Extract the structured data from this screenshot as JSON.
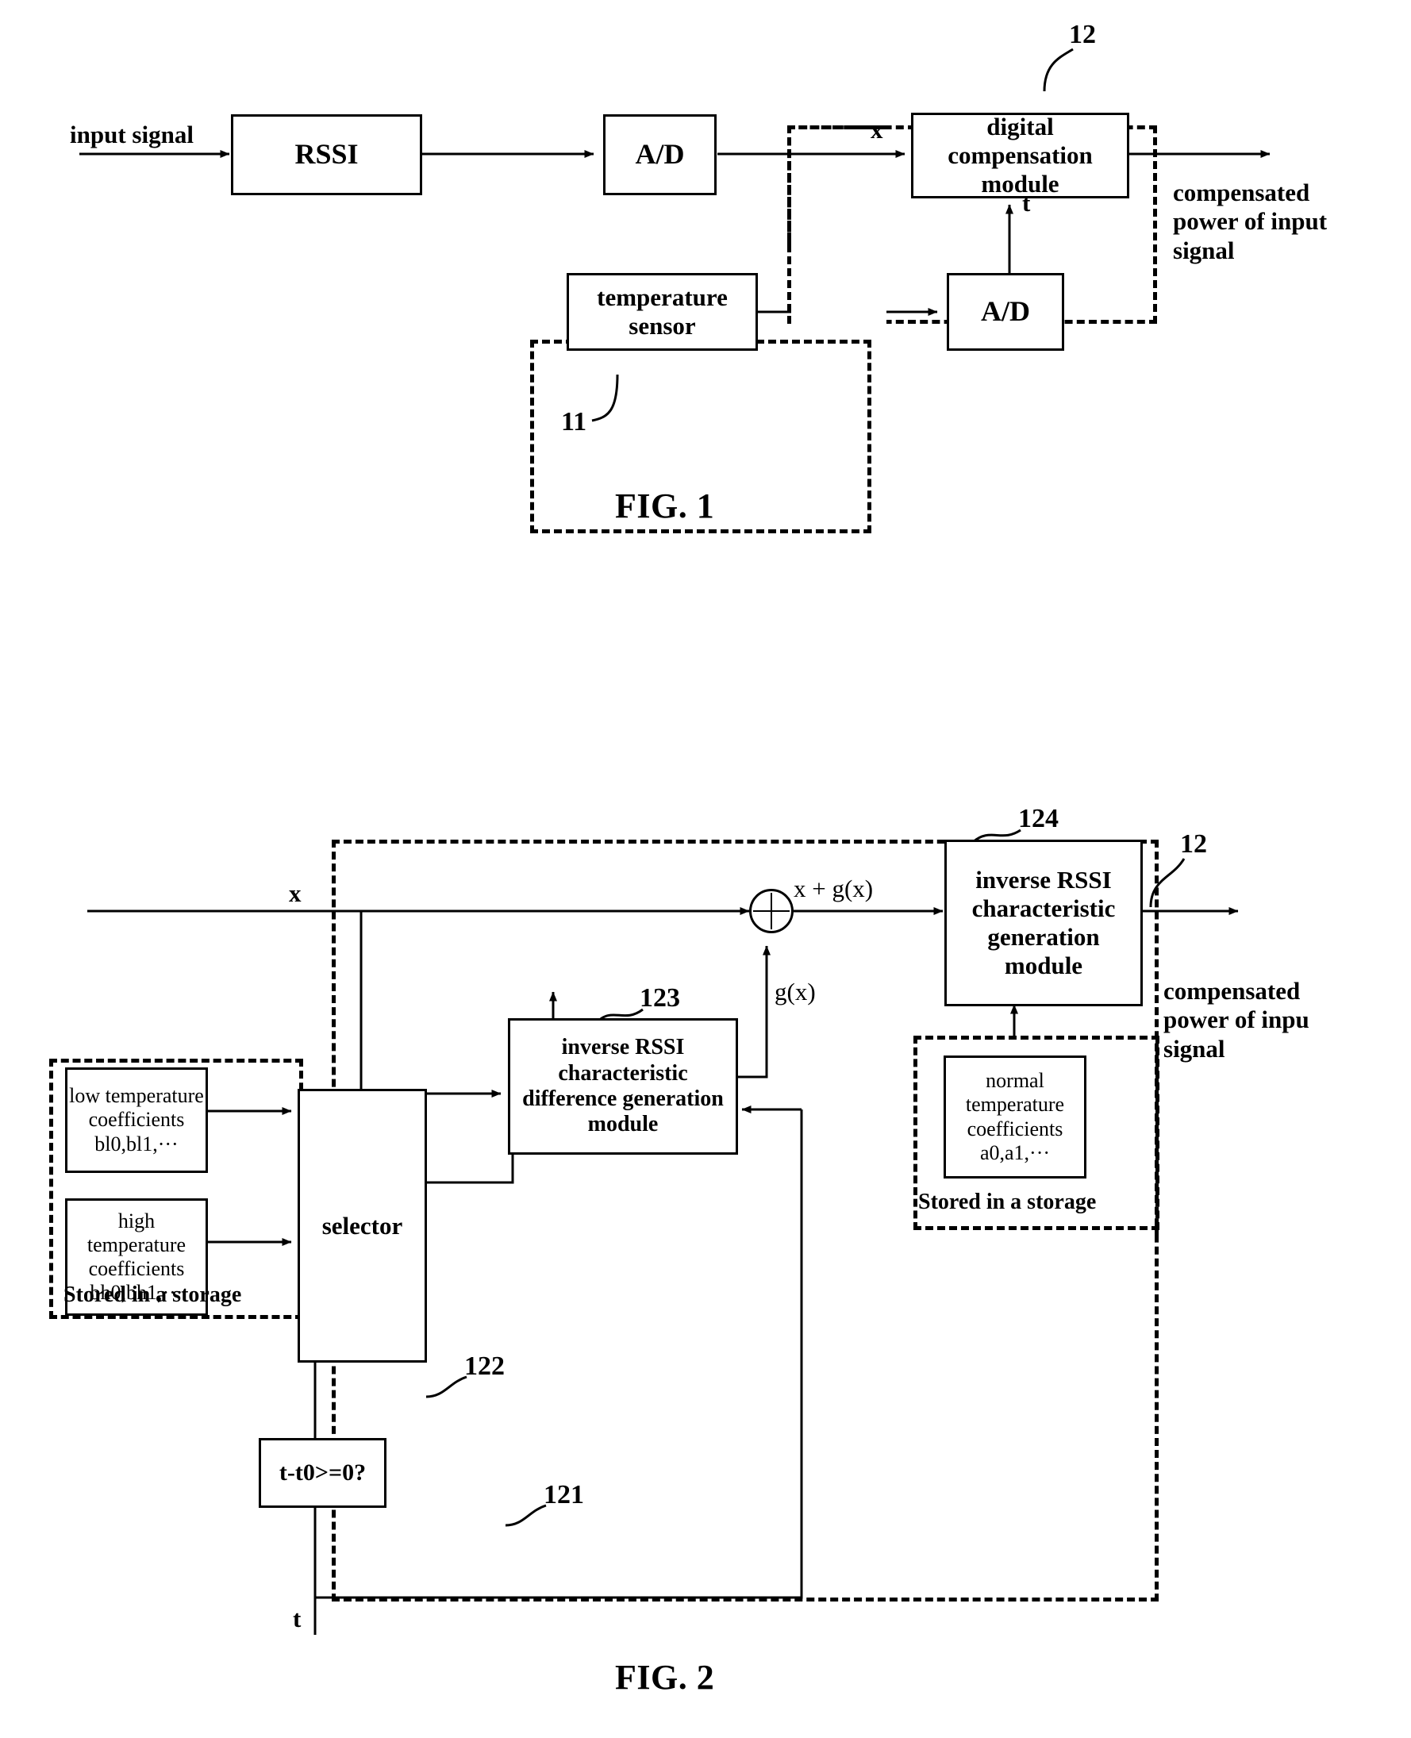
{
  "figures": [
    {
      "id": "fig1",
      "caption": "FIG. 1",
      "blocks": [
        {
          "key": "rssi",
          "label": "RSSI"
        },
        {
          "key": "ad1",
          "label": "A/D"
        },
        {
          "key": "digital_compensation",
          "label": "digital\ncompensation\nmodule"
        },
        {
          "key": "temperature_sensor",
          "label": "temperature\nsensor"
        },
        {
          "key": "ad2",
          "label": "A/D"
        }
      ],
      "signal_labels": {
        "input": "input signal",
        "x": "x",
        "t": "t",
        "output": "compensated\npower of input\nsignal"
      },
      "reference_numerals": {
        "compensation_unit": "12",
        "sensor_unit": "11"
      }
    },
    {
      "id": "fig2",
      "caption": "FIG. 2",
      "blocks": [
        {
          "key": "inverse_rssi_generation",
          "label": "inverse RSSI\ncharacteristic\ngeneration\nmodule"
        },
        {
          "key": "inverse_rssi_difference",
          "label": "inverse RSSI\ncharacteristic\ndifference generation\nmodule"
        },
        {
          "key": "selector",
          "label": "selector"
        },
        {
          "key": "comparator",
          "label": "t-t0>=0?"
        },
        {
          "key": "low_temp_coefficients",
          "label": "low temperature\ncoefficients\nbl0,bl1,···"
        },
        {
          "key": "high_temp_coefficients",
          "label": "high\ntemperature\ncoefficients\nbh0,bh1,···"
        },
        {
          "key": "normal_temp_coefficients",
          "label": "normal\ntemperature\ncoefficients\na0,a1,···"
        }
      ],
      "signal_labels": {
        "x": "x",
        "sum": "x + g(x)",
        "gx": "g(x)",
        "t": "t",
        "output": "compensated\npower of inpu\nsignal"
      },
      "storage_notes": {
        "left": "Stored in a storage",
        "right": "Stored in a storage"
      },
      "reference_numerals": {
        "compensation_unit": "12",
        "generation_module": "124",
        "difference_module": "123",
        "selector": "122",
        "comparator": "121"
      }
    }
  ]
}
